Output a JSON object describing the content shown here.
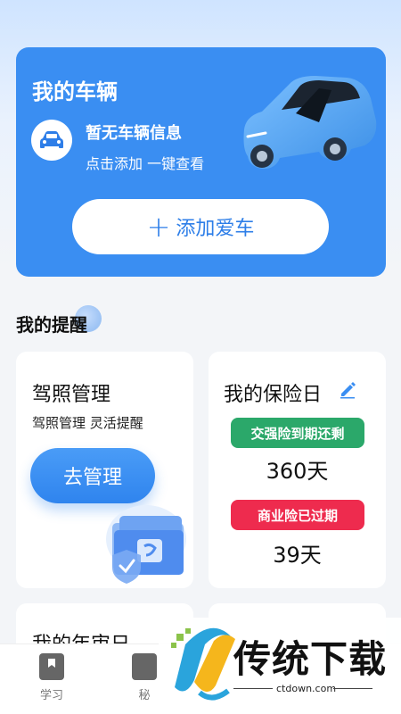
{
  "vehicle_card": {
    "title": "我的车辆",
    "status": "暂无车辆信息",
    "hint": "点击添加 一键查看",
    "add_button_icon": "+",
    "add_button_label": "添加爱车"
  },
  "reminders": {
    "title": "我的提醒"
  },
  "license_card": {
    "title": "驾照管理",
    "subtitle": "驾照管理 灵活提醒",
    "button_label": "去管理"
  },
  "insurance_card": {
    "title": "我的保险日",
    "compulsory_badge": "交强险到期还剩",
    "compulsory_days": "360天",
    "commercial_badge": "商业险已过期",
    "commercial_days": "39天"
  },
  "review_card": {
    "title": "我的年审日"
  },
  "bottom_nav": {
    "items": [
      {
        "label": "学习",
        "icon": "book-icon"
      },
      {
        "label": "秘",
        "icon": "secret-icon"
      }
    ]
  },
  "watermark": {
    "text": "传统下载",
    "url": "ctdown.com"
  },
  "colors": {
    "primary": "#3a8ef2",
    "green_badge": "#2ba86a",
    "red_badge": "#ee2b4e"
  }
}
